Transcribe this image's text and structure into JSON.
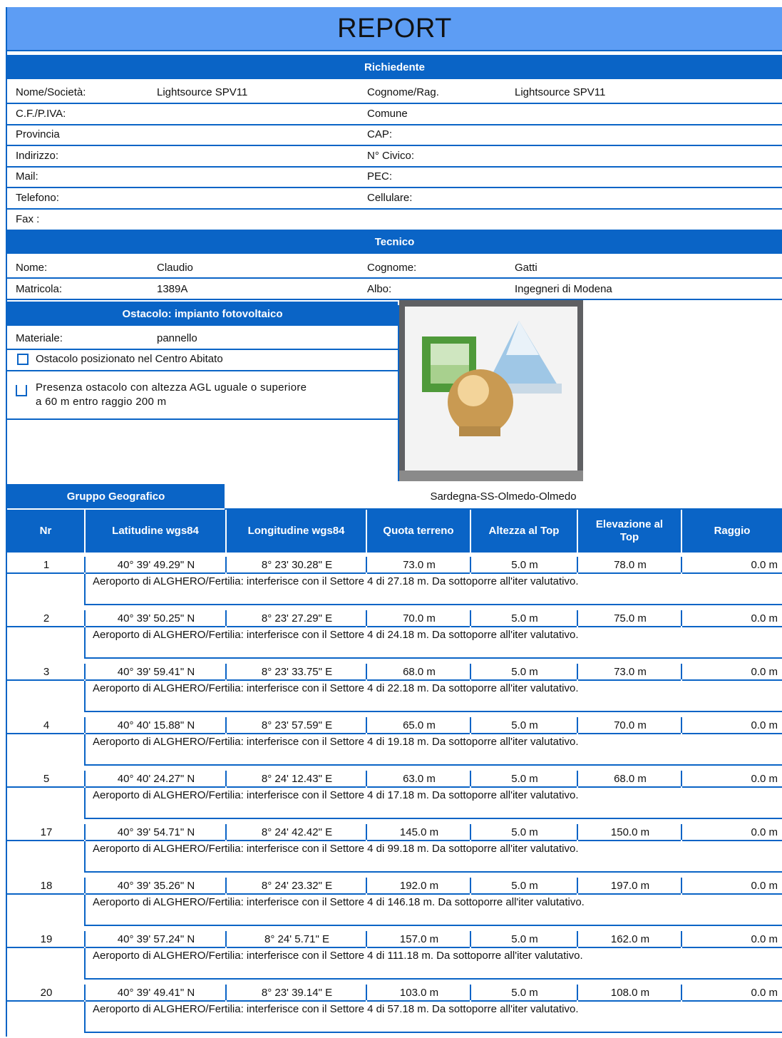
{
  "title": "REPORT",
  "requester": {
    "header": "Richiedente",
    "rows": [
      {
        "l1": "Nome/Società:",
        "v1": "Lightsource SPV11",
        "l2": "Cognome/Rag.",
        "v2": "Lightsource SPV11"
      },
      {
        "l1": "C.F./P.IVA:",
        "v1": "",
        "l2": "Comune",
        "v2": ""
      },
      {
        "l1": "Provincia",
        "v1": "",
        "l2": "CAP:",
        "v2": ""
      },
      {
        "l1": "Indirizzo:",
        "v1": "",
        "l2": "N° Civico:",
        "v2": ""
      },
      {
        "l1": "Mail:",
        "v1": "",
        "l2": "PEC:",
        "v2": ""
      },
      {
        "l1": "Telefono:",
        "v1": "",
        "l2": "Cellulare:",
        "v2": ""
      },
      {
        "l1": "Fax :",
        "v1": "",
        "l2": "",
        "v2": ""
      }
    ]
  },
  "technician": {
    "header": "Tecnico",
    "rows": [
      {
        "l1": "Nome:",
        "v1": "Claudio",
        "l2": "Cognome:",
        "v2": "Gatti"
      },
      {
        "l1": "Matricola:",
        "v1": "1389A",
        "l2": "Albo:",
        "v2": "Ingegneri di Modena"
      }
    ]
  },
  "obstacle": {
    "header": "Ostacolo: impianto fotovoltaico",
    "material_label": "Materiale:",
    "material_value": "pannello",
    "check1": "Ostacolo posizionato nel Centro Abitato",
    "check2_line1": "Presenza ostacolo con altezza AGL uguale o superiore",
    "check2_line2": "a 60 m entro raggio 200 m"
  },
  "geo": {
    "label": "Gruppo Geografico",
    "value": "Sardegna-SS-Olmedo-Olmedo"
  },
  "table": {
    "headers": [
      "Nr",
      "Latitudine wgs84",
      "Longitudine wgs84",
      "Quota terreno",
      "Altezza al Top",
      "Elevazione al Top",
      "Raggio"
    ],
    "rows": [
      {
        "nr": "1",
        "lat": "40° 39' 49.29\" N",
        "lon": "8° 23' 30.28\" E",
        "quota": "73.0 m",
        "altezza": "5.0 m",
        "elev": "78.0 m",
        "raggio": "0.0 m",
        "note": "Aeroporto di ALGHERO/Fertilia: interferisce con il  Settore 4  di 27.18 m. Da sottoporre all'iter valutativo."
      },
      {
        "nr": "2",
        "lat": "40° 39' 50.25\" N",
        "lon": "8° 23' 27.29\" E",
        "quota": "70.0 m",
        "altezza": "5.0 m",
        "elev": "75.0 m",
        "raggio": "0.0 m",
        "note": "Aeroporto di ALGHERO/Fertilia: interferisce con il  Settore 4  di 24.18 m. Da sottoporre all'iter valutativo."
      },
      {
        "nr": "3",
        "lat": "40° 39' 59.41\" N",
        "lon": "8° 23' 33.75\" E",
        "quota": "68.0 m",
        "altezza": "5.0 m",
        "elev": "73.0 m",
        "raggio": "0.0 m",
        "note": "Aeroporto di ALGHERO/Fertilia: interferisce con il  Settore 4  di 22.18 m. Da sottoporre all'iter valutativo."
      },
      {
        "nr": "4",
        "lat": "40° 40' 15.88\" N",
        "lon": "8° 23' 57.59\" E",
        "quota": "65.0 m",
        "altezza": "5.0 m",
        "elev": "70.0 m",
        "raggio": "0.0 m",
        "note": "Aeroporto di ALGHERO/Fertilia: interferisce con il  Settore 4  di 19.18 m. Da sottoporre all'iter valutativo."
      },
      {
        "nr": "5",
        "lat": "40° 40' 24.27\" N",
        "lon": "8° 24' 12.43\" E",
        "quota": "63.0 m",
        "altezza": "5.0 m",
        "elev": "68.0 m",
        "raggio": "0.0 m",
        "note": "Aeroporto di ALGHERO/Fertilia: interferisce con il  Settore 4  di 17.18 m. Da sottoporre all'iter valutativo."
      },
      {
        "nr": "17",
        "lat": "40° 39' 54.71\" N",
        "lon": "8° 24' 42.42\" E",
        "quota": "145.0 m",
        "altezza": "5.0 m",
        "elev": "150.0 m",
        "raggio": "0.0 m",
        "note": "Aeroporto di ALGHERO/Fertilia: interferisce con il  Settore 4  di 99.18 m. Da sottoporre all'iter valutativo."
      },
      {
        "nr": "18",
        "lat": "40° 39' 35.26\" N",
        "lon": "8° 24' 23.32\" E",
        "quota": "192.0 m",
        "altezza": "5.0 m",
        "elev": "197.0 m",
        "raggio": "0.0 m",
        "note": "Aeroporto di ALGHERO/Fertilia: interferisce con il  Settore 4  di 146.18 m. Da sottoporre all'iter valutativo."
      },
      {
        "nr": "19",
        "lat": "40° 39' 57.24\" N",
        "lon": "8° 24' 5.71\" E",
        "quota": "157.0 m",
        "altezza": "5.0 m",
        "elev": "162.0 m",
        "raggio": "0.0 m",
        "note": "Aeroporto di ALGHERO/Fertilia: interferisce con il  Settore 4  di 111.18 m. Da sottoporre all'iter valutativo."
      },
      {
        "nr": "20",
        "lat": "40° 39' 49.41\" N",
        "lon": "8° 23' 39.14\" E",
        "quota": "103.0 m",
        "altezza": "5.0 m",
        "elev": "108.0 m",
        "raggio": "0.0 m",
        "note": "Aeroporto di ALGHERO/Fertilia: interferisce con il  Settore 4  di 57.18 m. Da sottoporre all'iter valutativo."
      }
    ]
  },
  "colors": {
    "band": "#0a64c6",
    "title_bg": "#5d9df4"
  },
  "logo_icon": "geographic-application-icon"
}
